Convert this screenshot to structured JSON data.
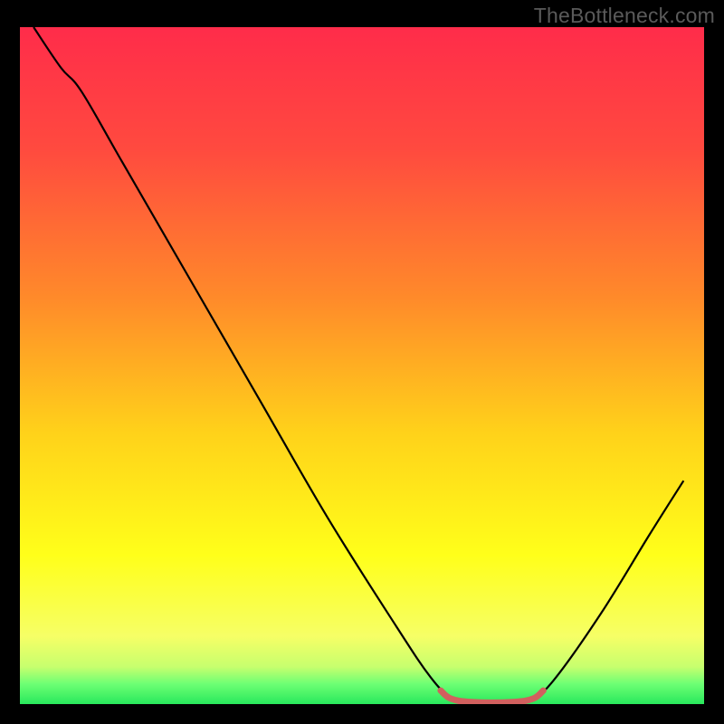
{
  "watermark": "TheBottleneck.com",
  "chart_data": {
    "type": "line",
    "title": "",
    "xlabel": "",
    "ylabel": "",
    "xlim": [
      0,
      100
    ],
    "ylim": [
      0,
      100
    ],
    "gradient_stops": [
      {
        "offset": 0.0,
        "color": "#ff2c4a"
      },
      {
        "offset": 0.18,
        "color": "#ff4a3f"
      },
      {
        "offset": 0.4,
        "color": "#ff8a2a"
      },
      {
        "offset": 0.6,
        "color": "#ffd21a"
      },
      {
        "offset": 0.78,
        "color": "#ffff1a"
      },
      {
        "offset": 0.9,
        "color": "#f6ff66"
      },
      {
        "offset": 0.945,
        "color": "#c7ff6e"
      },
      {
        "offset": 0.97,
        "color": "#6eff74"
      },
      {
        "offset": 1.0,
        "color": "#28e85c"
      }
    ],
    "series": [
      {
        "name": "bottleneck-curve",
        "color": "#000000",
        "points": [
          {
            "x": 2.0,
            "y": 100.0
          },
          {
            "x": 6.0,
            "y": 94.0
          },
          {
            "x": 9.0,
            "y": 90.5
          },
          {
            "x": 15.0,
            "y": 80.0
          },
          {
            "x": 25.0,
            "y": 62.5
          },
          {
            "x": 35.0,
            "y": 45.0
          },
          {
            "x": 45.0,
            "y": 27.5
          },
          {
            "x": 55.0,
            "y": 11.5
          },
          {
            "x": 60.0,
            "y": 4.0
          },
          {
            "x": 63.0,
            "y": 1.0
          },
          {
            "x": 66.0,
            "y": 0.2
          },
          {
            "x": 72.0,
            "y": 0.2
          },
          {
            "x": 75.0,
            "y": 1.0
          },
          {
            "x": 78.0,
            "y": 3.5
          },
          {
            "x": 85.0,
            "y": 13.5
          },
          {
            "x": 92.0,
            "y": 25.0
          },
          {
            "x": 97.0,
            "y": 33.0
          }
        ]
      },
      {
        "name": "optimal-range-marker",
        "color": "#d1605e",
        "points": [
          {
            "x": 61.5,
            "y": 2.0
          },
          {
            "x": 63.0,
            "y": 0.8
          },
          {
            "x": 66.0,
            "y": 0.3
          },
          {
            "x": 72.0,
            "y": 0.3
          },
          {
            "x": 75.0,
            "y": 0.8
          },
          {
            "x": 76.5,
            "y": 2.0
          }
        ]
      }
    ]
  }
}
